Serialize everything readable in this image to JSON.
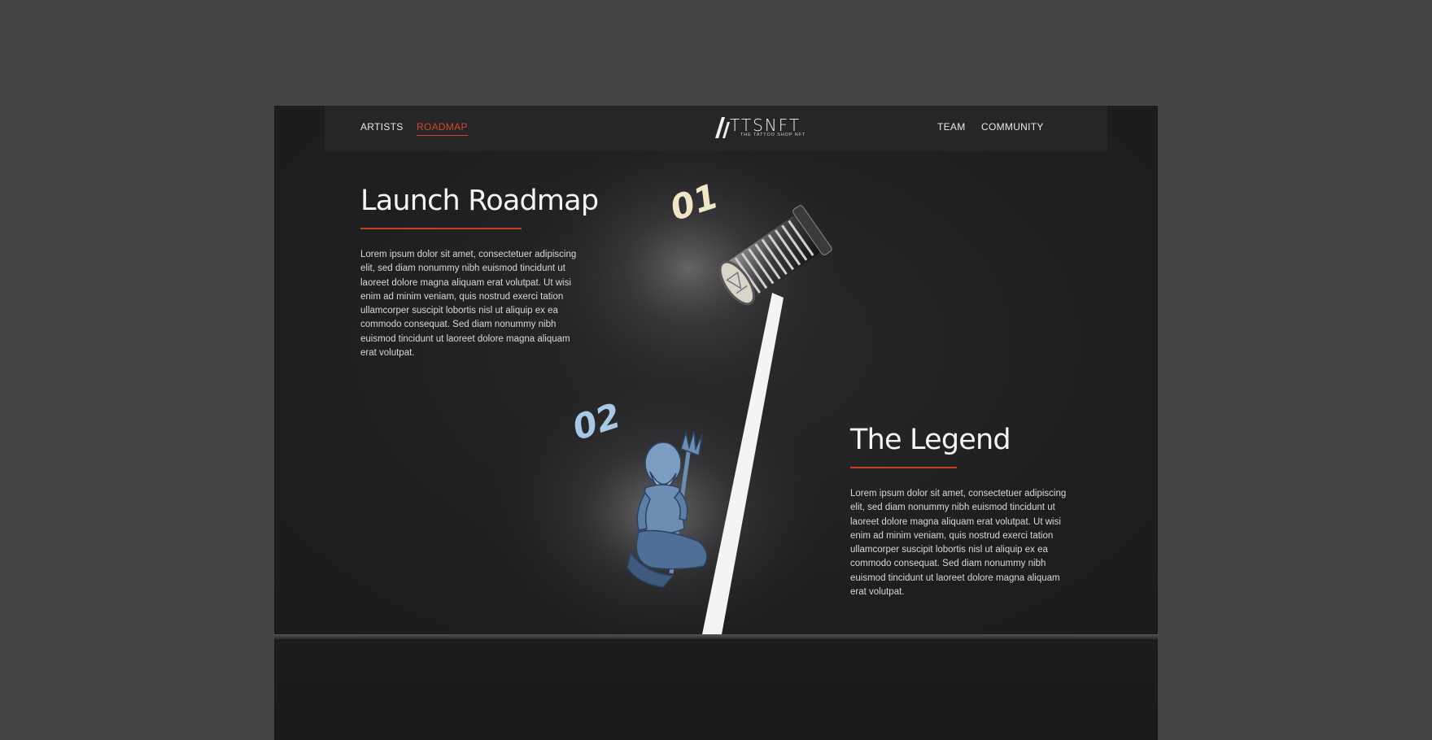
{
  "nav": {
    "left": [
      {
        "label": "ARTISTS",
        "active": false
      },
      {
        "label": "ROADMAP",
        "active": true
      }
    ],
    "right": [
      {
        "label": "TEAM"
      },
      {
        "label": "COMMUNITY"
      }
    ],
    "logo": {
      "wordmark": "TTSNFT",
      "tagline": "THE TATTOO SHOP NFT"
    }
  },
  "sections": [
    {
      "number": "01",
      "title": "Launch Roadmap",
      "body": "Lorem ipsum dolor sit amet, consectetuer adipiscing elit, sed diam nonummy nibh euismod tincidunt ut laoreet dolore magna aliquam erat volutpat. Ut wisi enim ad minim veniam, quis nostrud exerci tation ullamcorper suscipit lobortis nisl ut aliquip ex ea commodo consequat. Sed diam nonummy nibh euismod tincidunt ut laoreet dolore magna aliquam erat volutpat.",
      "illustration": "tattoo-machine-icon"
    },
    {
      "number": "02",
      "title": "The Legend",
      "body": "Lorem ipsum dolor sit amet, consectetuer adipiscing elit, sed diam nonummy nibh euismod tincidunt ut laoreet dolore magna aliquam erat volutpat. Ut wisi enim ad minim veniam, quis nostrud exerci tation ullamcorper suscipit lobortis nisl ut aliquip ex ea commodo consequat. Sed diam nonummy nibh euismod tincidunt ut laoreet dolore magna aliquam erat volutpat.",
      "illustration": "poseidon-statue-icon"
    }
  ],
  "colors": {
    "accent": "#c5401f",
    "background": "#1f1f21",
    "outer": "#454545",
    "num1": "#efe6c8",
    "num2": "#a9c8e6"
  }
}
